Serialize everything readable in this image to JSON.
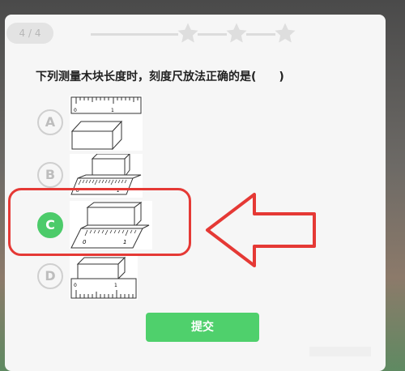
{
  "progress": {
    "label": "4 / 4",
    "current": 4,
    "total": 4
  },
  "question": {
    "text": "下列测量木块长度时，刻度尺放法正确的是(　　)"
  },
  "options": [
    {
      "letter": "A",
      "selected": false,
      "tick_labels": [
        "0",
        "1"
      ]
    },
    {
      "letter": "B",
      "selected": false,
      "tick_labels": [
        "0",
        "1"
      ]
    },
    {
      "letter": "C",
      "selected": true,
      "tick_labels": [
        "0",
        "1"
      ]
    },
    {
      "letter": "D",
      "selected": false,
      "tick_labels": [
        "0",
        "1"
      ]
    }
  ],
  "submit": {
    "label": "提交"
  },
  "colors": {
    "accent": "#4ccb6a",
    "annotation": "#e53935",
    "muted": "#cfcfcf"
  },
  "icons": {
    "progress_star": "star-icon"
  }
}
